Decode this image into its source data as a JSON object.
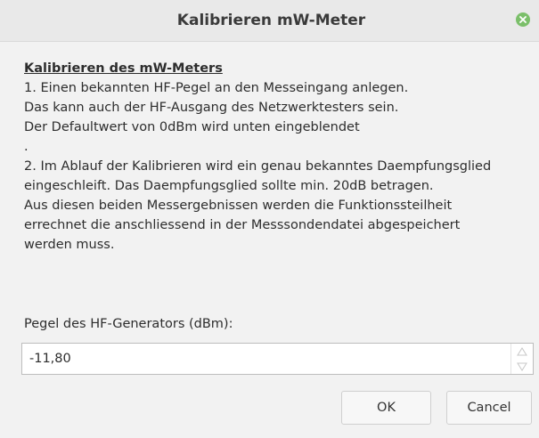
{
  "window": {
    "title": "Kalibrieren mW-Meter",
    "close_icon": "close-icon"
  },
  "content": {
    "heading": "Kalibrieren des mW-Meters",
    "lines": [
      "1. Einen bekannten HF-Pegel an den Messeingang anlegen.",
      "Das kann auch der HF-Ausgang des Netzwerktesters sein.",
      "Der Defaultwert von 0dBm wird unten eingeblendet",
      ".",
      "2. Im Ablauf der Kalibrieren wird ein genau bekanntes Daempfungsglied",
      "eingeschleift. Das Daempfungsglied sollte min. 20dB betragen.",
      "Aus diesen beiden Messergebnissen werden die Funktionssteilheit",
      "errechnet die anschliessend in der Messsondendatei abgespeichert",
      "werden muss."
    ]
  },
  "field": {
    "label": "Pegel des HF-Generators (dBm):",
    "value": "-11,80"
  },
  "buttons": {
    "ok": "OK",
    "cancel": "Cancel"
  },
  "colors": {
    "titlebar": "#e9e9e9",
    "close_button": "#7bbf6a",
    "dialog_background": "#f2f2f2"
  }
}
